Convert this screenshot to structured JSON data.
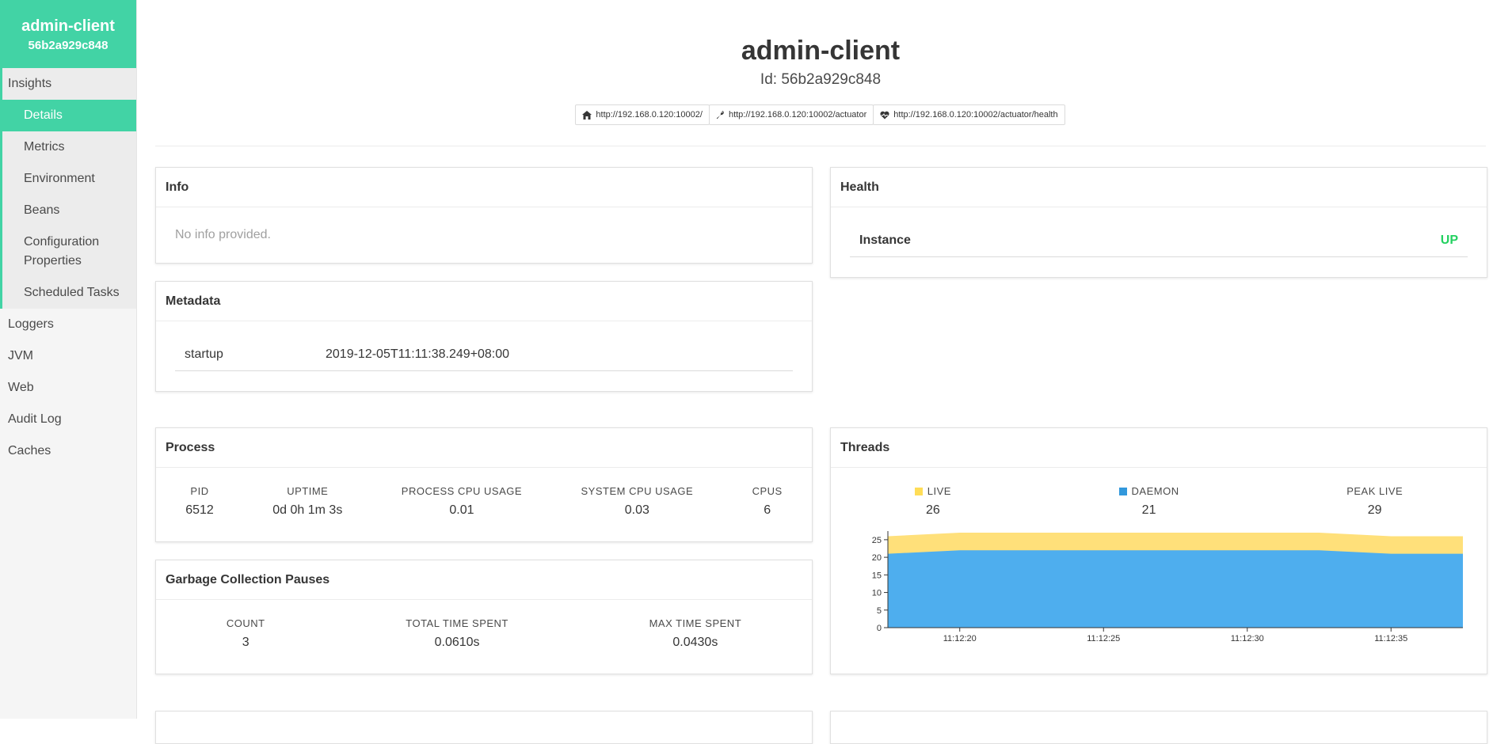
{
  "app": {
    "name": "admin-client",
    "id_short": "56b2a929c848",
    "id_line": "Id: 56b2a929c848"
  },
  "sidebar": {
    "group": "Insights",
    "sub_items": [
      {
        "label": "Details",
        "active": true
      },
      {
        "label": "Metrics"
      },
      {
        "label": "Environment"
      },
      {
        "label": "Beans"
      },
      {
        "label": "Configuration Properties"
      },
      {
        "label": "Scheduled Tasks"
      }
    ],
    "items": [
      {
        "label": "Loggers"
      },
      {
        "label": "JVM"
      },
      {
        "label": "Web"
      },
      {
        "label": "Audit Log"
      },
      {
        "label": "Caches"
      }
    ]
  },
  "links": [
    {
      "icon": "home-icon",
      "text": "http://192.168.0.120:10002/"
    },
    {
      "icon": "wrench-icon",
      "text": "http://192.168.0.120:10002/actuator"
    },
    {
      "icon": "heartbeat-icon",
      "text": "http://192.168.0.120:10002/actuator/health"
    }
  ],
  "info": {
    "title": "Info",
    "empty_text": "No info provided."
  },
  "metadata": {
    "title": "Metadata",
    "rows": [
      {
        "key": "startup",
        "value": "2019-12-05T11:11:38.249+08:00"
      }
    ]
  },
  "health": {
    "title": "Health",
    "rows": [
      {
        "key": "Instance",
        "status": "UP"
      }
    ],
    "status_color": "#23d160"
  },
  "process": {
    "title": "Process",
    "stats": [
      {
        "label": "PID",
        "value": "6512"
      },
      {
        "label": "UPTIME",
        "value": "0d 0h 1m 3s"
      },
      {
        "label": "PROCESS CPU USAGE",
        "value": "0.01"
      },
      {
        "label": "SYSTEM CPU USAGE",
        "value": "0.03"
      },
      {
        "label": "CPUS",
        "value": "6"
      }
    ]
  },
  "gc": {
    "title": "Garbage Collection Pauses",
    "stats": [
      {
        "label": "COUNT",
        "value": "3"
      },
      {
        "label": "TOTAL TIME SPENT",
        "value": "0.0610s"
      },
      {
        "label": "MAX TIME SPENT",
        "value": "0.0430s"
      }
    ]
  },
  "threads": {
    "title": "Threads",
    "legend": [
      {
        "label": "LIVE",
        "value": "26",
        "color": "#ffdd57"
      },
      {
        "label": "DAEMON",
        "value": "21",
        "color": "#3298dc"
      },
      {
        "label": "PEAK LIVE",
        "value": "29",
        "color": ""
      }
    ]
  },
  "chart_data": {
    "type": "area",
    "x": [
      "11:12:18",
      "11:12:20",
      "11:12:22",
      "11:12:25",
      "11:12:28",
      "11:12:30",
      "11:12:33",
      "11:12:35",
      "11:12:38"
    ],
    "x_ticks": [
      "11:12:20",
      "11:12:25",
      "11:12:30",
      "11:12:35"
    ],
    "y_ticks": [
      "0",
      "5",
      "10",
      "15",
      "20",
      "25"
    ],
    "ylim": [
      0,
      27
    ],
    "series": [
      {
        "name": "DAEMON",
        "values": [
          21,
          22,
          22,
          22,
          22,
          22,
          22,
          21,
          21
        ],
        "color": "#4eaeee"
      },
      {
        "name": "LIVE",
        "values": [
          26,
          27,
          27,
          27,
          27,
          27,
          27,
          26,
          26
        ],
        "color": "#ffe07a"
      }
    ],
    "title": "",
    "xlabel": "",
    "ylabel": ""
  }
}
